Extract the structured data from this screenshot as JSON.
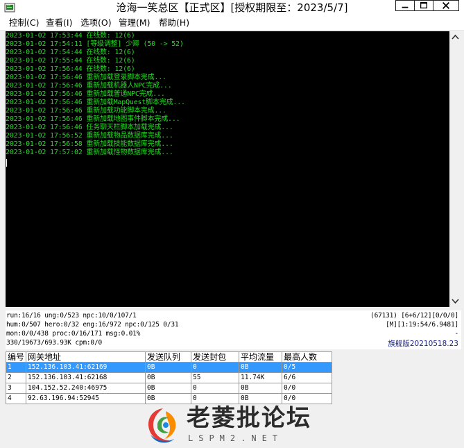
{
  "window": {
    "title": "沧海一笑总区【正式区】[授权期限至：2023/5/7]"
  },
  "menu": {
    "items": [
      {
        "label": "控制(C)"
      },
      {
        "label": "查看(I)"
      },
      {
        "label": "选项(O)"
      },
      {
        "label": "管理(M)"
      },
      {
        "label": "帮助(H)"
      }
    ]
  },
  "log": {
    "lines": [
      "2023-01-02 17:53:44 在线数: 12(6)",
      "2023-01-02 17:54:11 [等级调整] 少卿 (50 -> 52)",
      "2023-01-02 17:54:44 在线数: 12(6)",
      "2023-01-02 17:55:44 在线数: 12(6)",
      "2023-01-02 17:56:44 在线数: 12(6)",
      "2023-01-02 17:56:46 重新加载登录脚本完成...",
      "2023-01-02 17:56:46 重新加载机器人NPC完成...",
      "2023-01-02 17:56:46 重新加载普通NPC完成...",
      "2023-01-02 17:56:46 重新加载MapQuest脚本完成...",
      "2023-01-02 17:56:46 重新加载功能脚本完成...",
      "2023-01-02 17:56:46 重新加载地图事件脚本完成...",
      "2023-01-02 17:56:46 任务聊天栏脚本加载完成...",
      "2023-01-02 17:56:52 重新加载物品数据库完成...",
      "2023-01-02 17:56:58 重新加载技能数据库完成...",
      "2023-01-02 17:57:02 重新加载怪物数据库完成..."
    ]
  },
  "status": {
    "line1": "run:16/16 ung:0/523 npc:10/0/107/1",
    "line1_right": "(67131) [6+6/12][0/0/0]",
    "line2": "hum:0/507 hero:0/32 eng:16/972 npc:0/125 0/31",
    "line2_right": "[M][1:19:54/6.9481]",
    "line3": "mon:0/0/438 proc:0/16/171 msg:0.01%",
    "line3_right": "-",
    "line4": "330/19673/693.93K cpm:0/0",
    "version": "旗舰版20210518.23"
  },
  "table": {
    "headers": [
      "编号",
      "网关地址",
      "发送队列",
      "发送封包",
      "平均流量",
      "最高人数"
    ],
    "rows": [
      [
        "1",
        "152.136.103.41:62169",
        "0B",
        "0",
        "0B",
        "0/5"
      ],
      [
        "2",
        "152.136.103.41:62168",
        "0B",
        "55",
        "11.74K",
        "6/6"
      ],
      [
        "3",
        "104.152.52.240:46975",
        "0B",
        "0",
        "0B",
        "0/0"
      ],
      [
        "4",
        "92.63.196.94:52945",
        "0B",
        "0",
        "0B",
        "0/0"
      ]
    ],
    "selected_row": 0
  },
  "watermark": {
    "text": "老菱批论坛",
    "sub": "LSPM2.NET"
  },
  "colors": {
    "console_bg": "#000000",
    "console_text": "#22dd22",
    "selection": "#3399ff",
    "version_text": "#1a237e"
  }
}
